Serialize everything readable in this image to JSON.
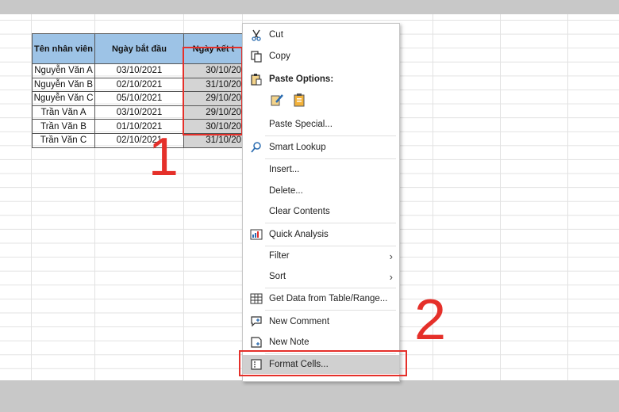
{
  "table": {
    "headers": [
      "Tên nhân viên",
      "Ngày bắt đầu",
      "Ngày kết t"
    ],
    "rows": [
      [
        "Nguyễn Văn A",
        "03/10/2021",
        "30/10/20"
      ],
      [
        "Nguyễn Văn B",
        "02/10/2021",
        "31/10/20"
      ],
      [
        "Nguyễn Văn C",
        "05/10/2021",
        "29/10/20"
      ],
      [
        "Trần Văn A",
        "03/10/2021",
        "29/10/20"
      ],
      [
        "Trần Văn B",
        "01/10/2021",
        "30/10/20"
      ],
      [
        "Trần Văn C",
        "02/10/2021",
        "31/10/20"
      ]
    ]
  },
  "annotations": {
    "step1": "1",
    "step2": "2",
    "accent_color": "#e5302a"
  },
  "menu": {
    "cut": "Cut",
    "copy": "Copy",
    "paste_options": "Paste Options:",
    "paste_special": "Paste Special...",
    "smart_lookup": "Smart Lookup",
    "insert": "Insert...",
    "delete": "Delete...",
    "clear_contents": "Clear Contents",
    "quick_analysis": "Quick Analysis",
    "filter": "Filter",
    "sort": "Sort",
    "get_data": "Get Data from Table/Range...",
    "new_comment": "New Comment",
    "new_note": "New Note",
    "format_cells": "Format Cells..."
  },
  "icons": [
    "scissors-icon",
    "copy-icon",
    "paste-icon",
    "paste-brush-icon",
    "paste-clipboard-icon",
    "search-icon",
    "quick-analysis-icon",
    "table-icon",
    "comment-icon",
    "note-icon",
    "format-cells-icon",
    "chevron-right-icon"
  ]
}
